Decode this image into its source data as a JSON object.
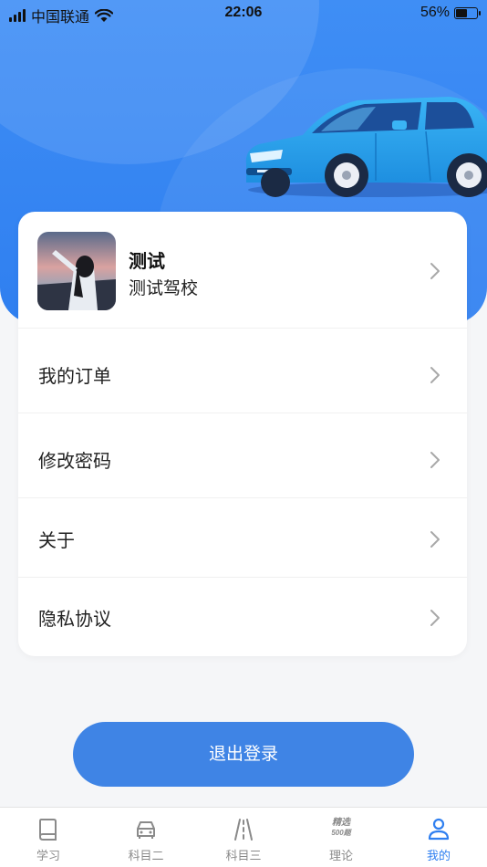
{
  "status_bar": {
    "carrier": "中国联通",
    "time": "22:06",
    "battery": "56%",
    "battery_level": 0.56
  },
  "profile": {
    "name": "测试",
    "school": "测试驾校"
  },
  "menu": {
    "items": [
      {
        "label": "我的订单"
      },
      {
        "label": "修改密码"
      },
      {
        "label": "关于"
      },
      {
        "label": "隐私协议"
      }
    ]
  },
  "logout_label": "退出登录",
  "tabs": [
    {
      "label": "学习",
      "icon": "book-icon"
    },
    {
      "label": "科目二",
      "icon": "car-icon"
    },
    {
      "label": "科目三",
      "icon": "road-icon"
    },
    {
      "label": "理论",
      "icon": "selected-500-icon",
      "icon_text_top": "精选",
      "icon_text_bottom": "500题"
    },
    {
      "label": "我的",
      "icon": "person-icon",
      "active": true
    }
  ],
  "colors": {
    "brand_blue": "#2f7ff0",
    "logout_button": "#3f84e5",
    "tab_inactive": "#8a8a8a"
  }
}
